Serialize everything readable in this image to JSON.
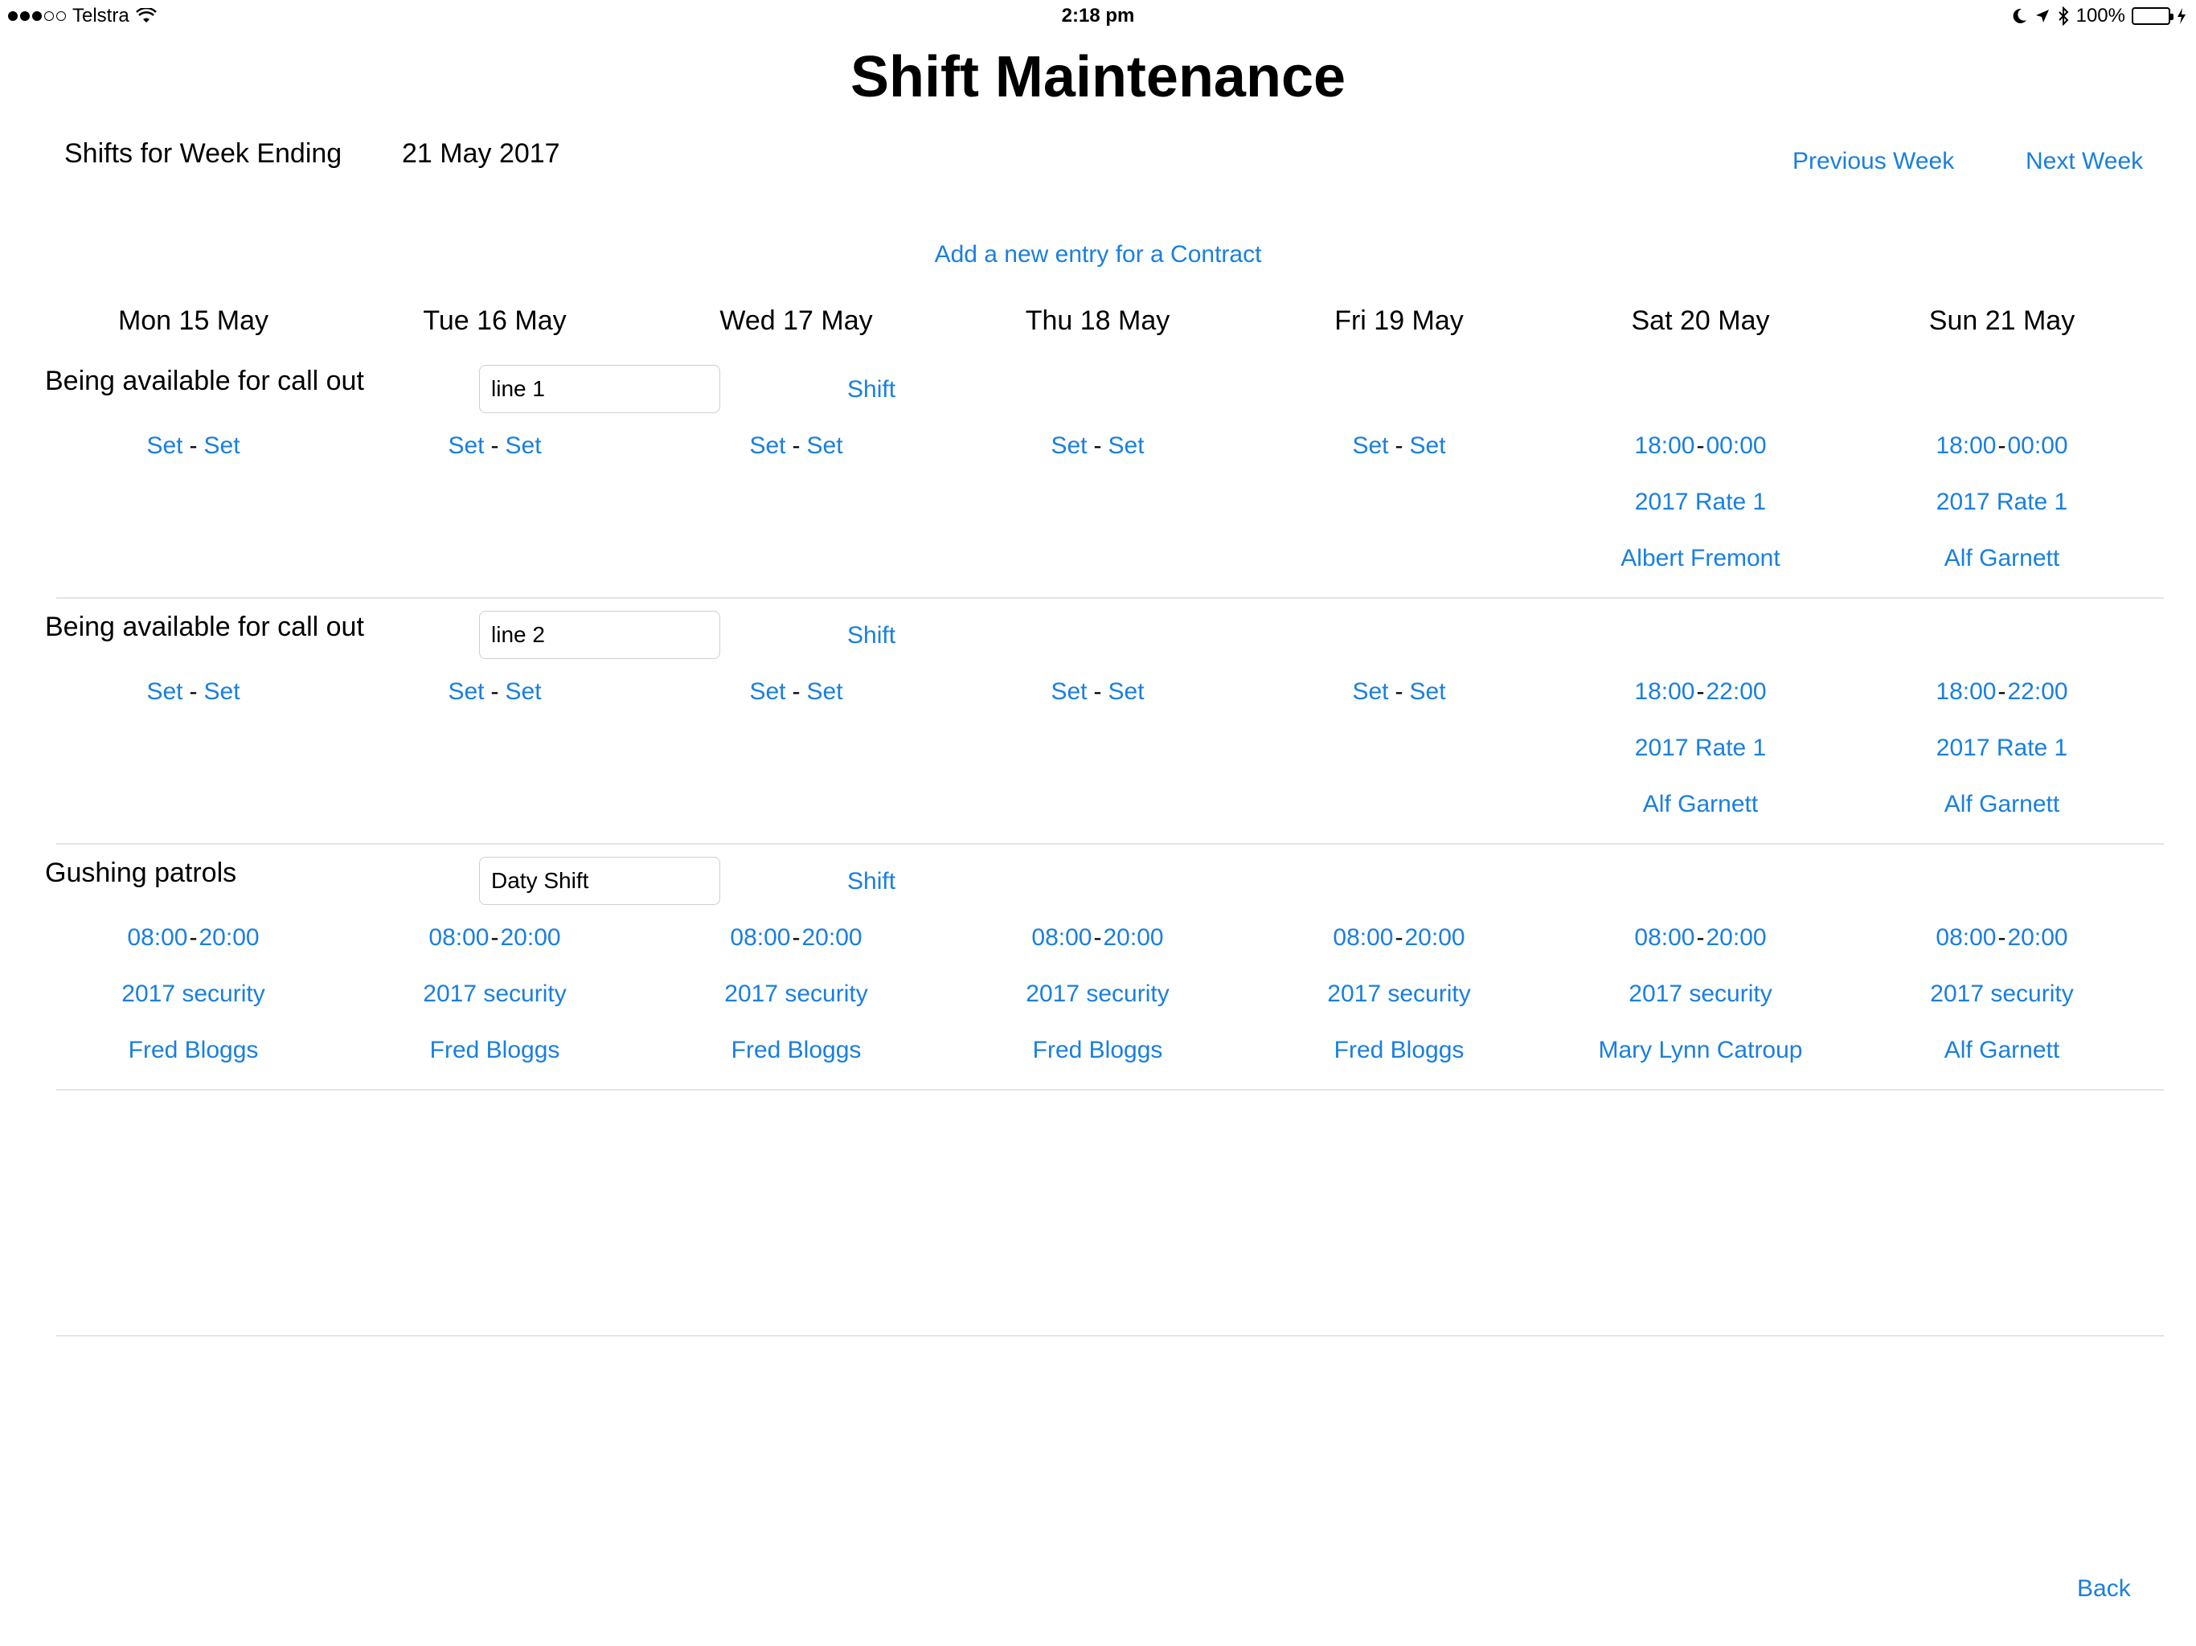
{
  "status_bar": {
    "carrier": "Telstra",
    "time": "2:18 pm",
    "battery": "100%"
  },
  "page": {
    "title": "Shift Maintenance",
    "week_label": "Shifts for Week Ending",
    "week_value": "21 May 2017",
    "previous_week": "Previous Week",
    "next_week": "Next Week",
    "add_entry": "Add a new entry for a Contract",
    "back": "Back"
  },
  "days": [
    "Mon 15 May",
    "Tue 16 May",
    "Wed 17 May",
    "Thu 18 May",
    "Fri 19 May",
    "Sat 20 May",
    "Sun 21 May"
  ],
  "rows": [
    {
      "title": "Being available for call out",
      "input_value": "line 1",
      "shift_label": "Shift",
      "cells": [
        {
          "start": "Set",
          "end": "Set",
          "rate": "",
          "person": ""
        },
        {
          "start": "Set",
          "end": "Set",
          "rate": "",
          "person": ""
        },
        {
          "start": "Set",
          "end": "Set",
          "rate": "",
          "person": ""
        },
        {
          "start": "Set",
          "end": "Set",
          "rate": "",
          "person": ""
        },
        {
          "start": "Set",
          "end": "Set",
          "rate": "",
          "person": ""
        },
        {
          "start": "18:00",
          "end": "00:00",
          "rate": "2017 Rate 1",
          "person": "Albert Fremont"
        },
        {
          "start": "18:00",
          "end": "00:00",
          "rate": "2017 Rate 1",
          "person": "Alf Garnett"
        }
      ]
    },
    {
      "title": "Being available for call out",
      "input_value": "line 2",
      "shift_label": "Shift",
      "cells": [
        {
          "start": "Set",
          "end": "Set",
          "rate": "",
          "person": ""
        },
        {
          "start": "Set",
          "end": "Set",
          "rate": "",
          "person": ""
        },
        {
          "start": "Set",
          "end": "Set",
          "rate": "",
          "person": ""
        },
        {
          "start": "Set",
          "end": "Set",
          "rate": "",
          "person": ""
        },
        {
          "start": "Set",
          "end": "Set",
          "rate": "",
          "person": ""
        },
        {
          "start": "18:00",
          "end": "22:00",
          "rate": "2017 Rate 1",
          "person": "Alf Garnett"
        },
        {
          "start": "18:00",
          "end": "22:00",
          "rate": "2017 Rate 1",
          "person": "Alf Garnett"
        }
      ]
    },
    {
      "title": "Gushing patrols",
      "input_value": "Daty Shift",
      "shift_label": "Shift",
      "cells": [
        {
          "start": "08:00",
          "end": "20:00",
          "rate": "2017 security",
          "person": "Fred Bloggs"
        },
        {
          "start": "08:00",
          "end": "20:00",
          "rate": "2017 security",
          "person": "Fred Bloggs"
        },
        {
          "start": "08:00",
          "end": "20:00",
          "rate": "2017 security",
          "person": "Fred Bloggs"
        },
        {
          "start": "08:00",
          "end": "20:00",
          "rate": "2017 security",
          "person": "Fred Bloggs"
        },
        {
          "start": "08:00",
          "end": "20:00",
          "rate": "2017 security",
          "person": "Fred Bloggs"
        },
        {
          "start": "08:00",
          "end": "20:00",
          "rate": "2017 security",
          "person": "Mary Lynn Catroup"
        },
        {
          "start": "08:00",
          "end": "20:00",
          "rate": "2017 security",
          "person": "Alf Garnett"
        }
      ]
    }
  ]
}
